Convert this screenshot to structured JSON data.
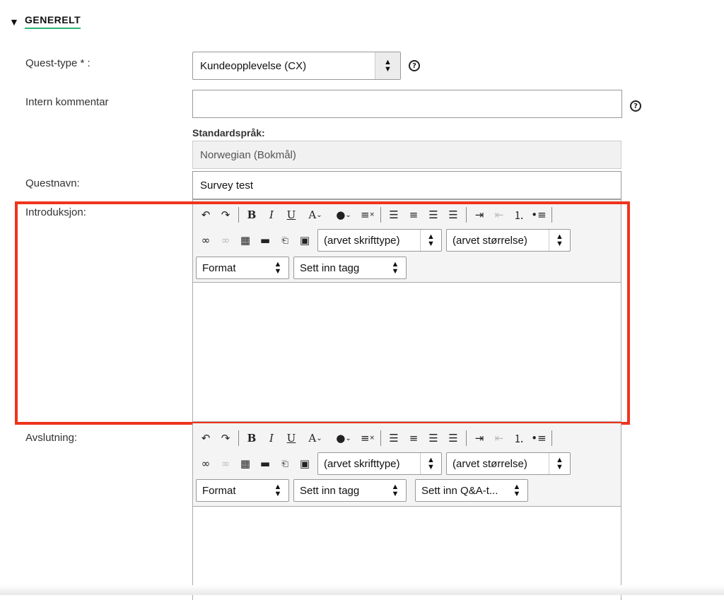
{
  "section": {
    "title": "GENERELT",
    "toggle": "▼"
  },
  "fields": {
    "quest_type_label": "Quest-type * :",
    "quest_type_value": "Kundeopplevelse (CX)",
    "internal_comment_label": "Intern kommentar",
    "internal_comment_value": "",
    "default_language_label": "Standardspråk:",
    "default_language_value": "Norwegian (Bokmål)",
    "quest_name_label": "Questnavn:",
    "quest_name_value": "Survey test",
    "intro_label": "Introduksjon:",
    "closing_label": "Avslutning:"
  },
  "help_icon": "?",
  "editor": {
    "font_select": "(arvet skrifttype)",
    "size_select": "(arvet størrelse)",
    "format_select": "Format",
    "tag_select": "Sett inn tagg",
    "qa_select": "Sett inn Q&A-t...",
    "icons": [
      "undo-icon",
      "redo-icon",
      "bold-icon",
      "italic-icon",
      "underline-icon",
      "text-color-icon",
      "bg-color-icon",
      "clear-format-icon",
      "align-left-icon",
      "align-center-icon",
      "align-right-icon",
      "justify-icon",
      "indent-icon",
      "outdent-icon",
      "numbered-list-icon",
      "bullet-list-icon",
      "link-icon",
      "unlink-icon",
      "table-icon",
      "hr-icon",
      "embed-icon",
      "image-icon"
    ]
  },
  "colors": {
    "accent": "#2bb673",
    "highlight": "#f0341c"
  }
}
